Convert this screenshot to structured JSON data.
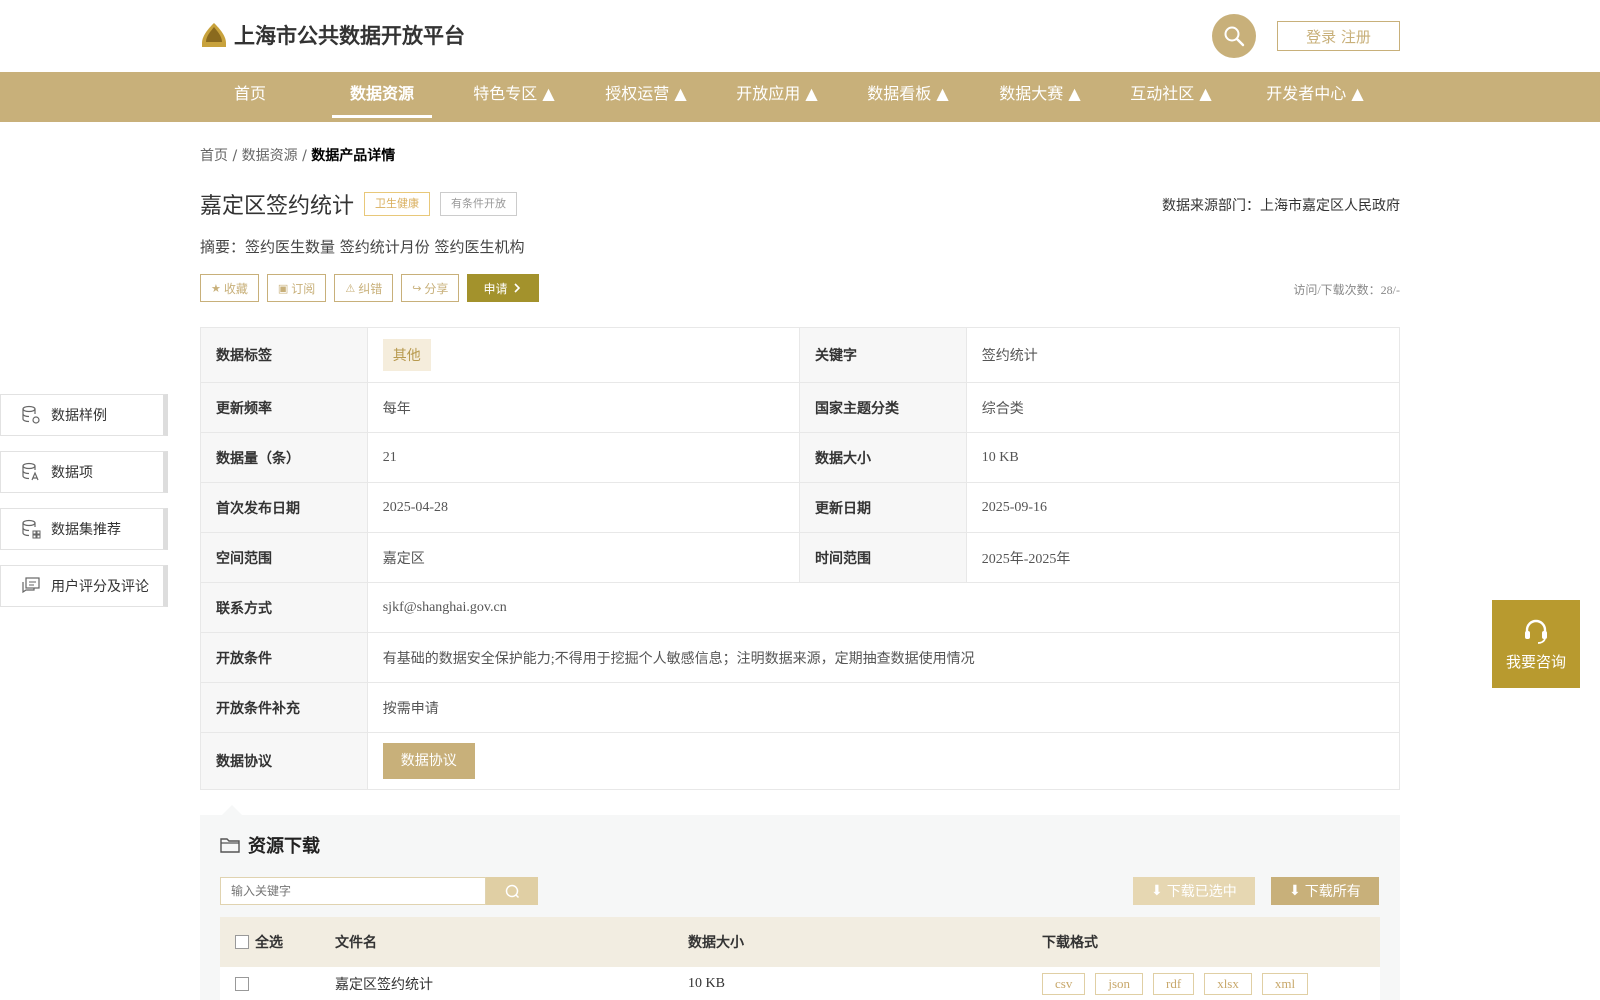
{
  "header": {
    "site_title": "上海市公共数据开放平台",
    "login_label": "登录 注册",
    "brand_color": "#c8b07a"
  },
  "nav": {
    "items": [
      {
        "label": "首页"
      },
      {
        "label": "数据资源",
        "active": true
      },
      {
        "label": "特色专区 ▲"
      },
      {
        "label": "授权运营 ▲"
      },
      {
        "label": "开放应用 ▲"
      },
      {
        "label": "数据看板 ▲"
      },
      {
        "label": "数据大赛 ▲"
      },
      {
        "label": "互动社区 ▲"
      },
      {
        "label": "开发者中心 ▲"
      }
    ]
  },
  "breadcrumb": {
    "home": "首页",
    "sep1": " / ",
    "resources": "数据资源",
    "sep2": " / ",
    "current": "数据产品详情"
  },
  "product": {
    "title": "嘉定区签约统计",
    "tag_topic": "卫生健康",
    "tag_open": "有条件开放",
    "source": "数据来源部门：上海市嘉定区人民政府",
    "summary": "摘要：签约医生数量 签约统计月份 签约医生机构",
    "visits": "访问/下载次数：28/-"
  },
  "actions": {
    "favorite": "收藏",
    "subscribe": "订阅",
    "report": "纠错",
    "share": "分享",
    "apply": "申请"
  },
  "info": {
    "tags_k": "数据标签",
    "tags_v": "其他",
    "keyword_k": "关键字",
    "keyword_v": "签约统计",
    "freq_k": "更新频率",
    "freq_v": "每年",
    "theme_k": "国家主题分类",
    "theme_v": "综合类",
    "count_k": "数据量（条）",
    "count_v": "21",
    "size_k": "数据大小",
    "size_v": "10 KB",
    "first_k": "首次发布日期",
    "first_v": "2025-04-28",
    "update_k": "更新日期",
    "update_v": "2025-09-16",
    "space_k": "空间范围",
    "space_v": "嘉定区",
    "time_k": "时间范围",
    "time_v": "2025年-2025年",
    "contact_k": "联系方式",
    "contact_v": "sjkf@shanghai.gov.cn",
    "cond_k": "开放条件",
    "cond_v": "有基础的数据安全保护能力;不得用于挖掘个人敏感信息；注明数据来源，定期抽查数据使用情况",
    "cond_extra_k": "开放条件补充",
    "cond_extra_v": "按需申请",
    "agreement_k": "数据协议",
    "agreement_btn": "数据协议"
  },
  "sidebar": {
    "items": [
      {
        "label": "数据样例",
        "icon": "database-gear-icon"
      },
      {
        "label": "数据项",
        "icon": "database-text-icon"
      },
      {
        "label": "数据集推荐",
        "icon": "database-grid-icon"
      },
      {
        "label": "用户评分及评论",
        "icon": "comment-icon"
      }
    ]
  },
  "consult": {
    "label": "我要咨询"
  },
  "download": {
    "title": "资源下载",
    "search_placeholder": "输入关键字",
    "download_selected": "下载已选中",
    "download_all": "下载所有",
    "columns": {
      "select_all": "全选",
      "filename": "文件名",
      "size": "数据大小",
      "formats": "下载格式"
    },
    "rows": [
      {
        "filename": "嘉定区签约统计",
        "size": "10 KB",
        "formats": [
          "csv",
          "json",
          "rdf",
          "xlsx",
          "xml"
        ]
      }
    ]
  }
}
